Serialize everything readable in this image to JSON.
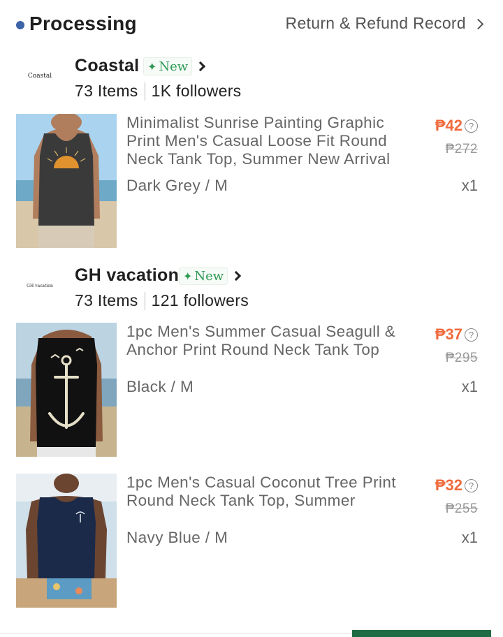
{
  "header": {
    "status": "Processing",
    "refund_link": "Return & Refund Record"
  },
  "stores": [
    {
      "logo_text": "Coastal",
      "name": "Coastal",
      "badge": "New",
      "items": "73 Items",
      "followers": "1K followers"
    },
    {
      "logo_text": "GH vacation",
      "name": "GH vacation",
      "badge": "New",
      "items": "73 Items",
      "followers": "121 followers"
    }
  ],
  "products": [
    {
      "title": "Minimalist Sunrise Painting Graphic Print Men's Casual Loose Fit Round Neck Tank Top, Summer New Arrival",
      "variant": "Dark Grey / M",
      "price": "₱42",
      "original_price": "₱272",
      "quantity": "x1",
      "tank_color": "#3a3a3a"
    },
    {
      "title": "1pc Men's Summer Casual Seagull & Anchor Print Round Neck Tank Top",
      "variant": "Black / M",
      "price": "₱37",
      "original_price": "₱295",
      "quantity": "x1",
      "tank_color": "#111111"
    },
    {
      "title": "1pc Men's Casual Coconut Tree Print Round Neck Tank Top, Summer",
      "variant": "Navy Blue / M",
      "price": "₱32",
      "original_price": "₱255",
      "quantity": "x1",
      "tank_color": "#1b2a48"
    }
  ],
  "colors": {
    "price": "#f06a3c",
    "new_badge": "#2e9a55",
    "status_dot": "#3d63a8",
    "primary_button": "#1f6b43"
  }
}
